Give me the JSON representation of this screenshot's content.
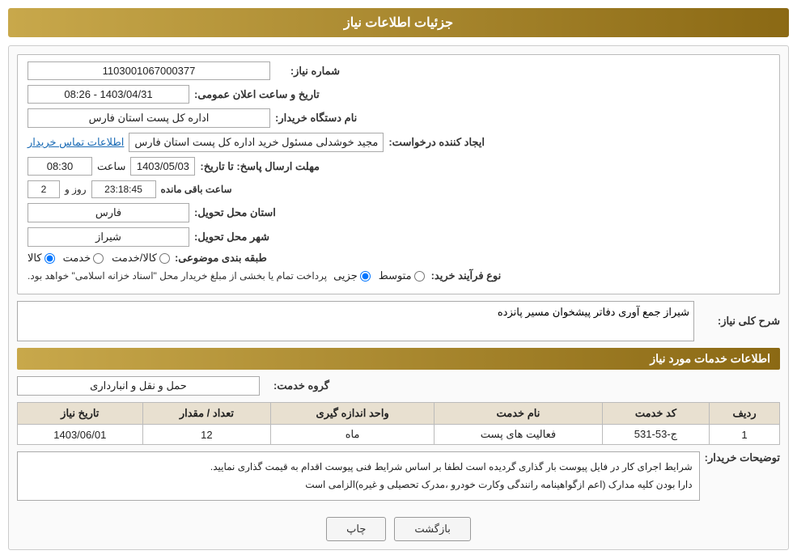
{
  "header": {
    "title": "جزئیات اطلاعات نیاز"
  },
  "fields": {
    "need_number_label": "شماره نیاز:",
    "need_number_value": "1103001067000377",
    "announce_datetime_label": "تاریخ و ساعت اعلان عمومی:",
    "announce_datetime_value": "1403/04/31 - 08:26",
    "buyer_org_label": "نام دستگاه خریدار:",
    "buyer_org_value": "اداره کل پست استان فارس",
    "creator_label": "ایجاد کننده درخواست:",
    "creator_value": "مجید خوشدلی مسئول خرید اداره کل پست استان فارس",
    "contact_link": "اطلاعات تماس خریدار",
    "reply_deadline_label": "مهلت ارسال پاسخ: تا تاریخ:",
    "reply_date": "1403/05/03",
    "reply_time_label": "ساعت",
    "reply_time": "08:30",
    "remaining_days_label": "روز و",
    "remaining_days": "2",
    "remaining_time": "23:18:45",
    "remaining_suffix": "ساعت باقی مانده",
    "province_label": "استان محل تحویل:",
    "province_value": "فارس",
    "city_label": "شهر محل تحویل:",
    "city_value": "شیراز",
    "category_label": "طبقه بندی موضوعی:",
    "category_options": [
      "کالا",
      "خدمت",
      "کالا/خدمت"
    ],
    "category_selected": "کالا",
    "purchase_type_label": "نوع فرآیند خرید:",
    "purchase_type_options": [
      "جزیی",
      "متوسط"
    ],
    "purchase_type_note": "پرداخت تمام یا بخشی از مبلغ خریدار محل \"اسناد خزانه اسلامی\" خواهد بود.",
    "description_label": "شرح کلی نیاز:",
    "description_value": "شیراز جمع آوری دفاتر پیشخوان مسیر پانزده",
    "services_title": "اطلاعات خدمات مورد نیاز",
    "service_group_label": "گروه خدمت:",
    "service_group_value": "حمل و نقل و انبارداری",
    "table": {
      "headers": [
        "ردیف",
        "کد خدمت",
        "نام خدمت",
        "واحد اندازه گیری",
        "تعداد / مقدار",
        "تاریخ نیاز"
      ],
      "rows": [
        [
          "1",
          "ج-53-531",
          "فعالیت های پست",
          "ماه",
          "12",
          "1403/06/01"
        ]
      ]
    },
    "buyer_notes_label": "توضیحات خریدار:",
    "buyer_notes_value": "شرایط اجرای کار در فایل پیوست بار گذاری گردیده است لطفا بر اساس شرایط فنی پیوست اقدام به قیمت گذاری نمایید.\nدارا بودن کلیه مدارک (اعم ازگواهینامه رانندگی وکارت خودرو ،مدرک تحصیلی و غیره)الزامی است",
    "buttons": {
      "back_label": "بازگشت",
      "print_label": "چاپ"
    }
  }
}
